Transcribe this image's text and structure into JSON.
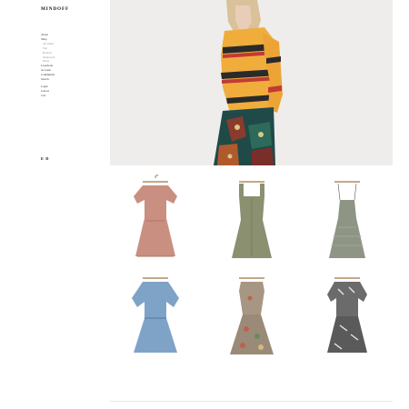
{
  "brand": {
    "logo": "MINDOFF"
  },
  "nav": {
    "items": [
      {
        "label": "About",
        "sub": false
      },
      {
        "label": "Shop",
        "sub": false
      },
      {
        "label": "All Items",
        "sub": true
      },
      {
        "label": "Top",
        "sub": true
      },
      {
        "label": "Bottom",
        "sub": true
      },
      {
        "label": "Outerwear",
        "sub": true
      },
      {
        "label": "Dress",
        "sub": true
      },
      {
        "label": "Lookbook",
        "sub": false
      },
      {
        "label": "Account",
        "sub": false
      },
      {
        "label": "Community",
        "sub": false
      },
      {
        "label": "Search",
        "sub": false
      }
    ],
    "account_items": [
      {
        "label": "Login"
      },
      {
        "label": "Join us"
      },
      {
        "label": "Cart"
      }
    ]
  },
  "language": {
    "label": "E D"
  },
  "products": [
    {
      "name": "puff-sleeve-dress-pink",
      "color": "#c98f80"
    },
    {
      "name": "square-neck-dress-olive",
      "color": "#8a9070"
    },
    {
      "name": "slip-dress-check",
      "color": "#8f9585"
    },
    {
      "name": "smocked-dress-blue",
      "color": "#7fa3c7"
    },
    {
      "name": "floral-tie-dress",
      "color": "#9a8a78"
    },
    {
      "name": "black-white-floral-dress",
      "color": "#6b6b6b"
    }
  ]
}
